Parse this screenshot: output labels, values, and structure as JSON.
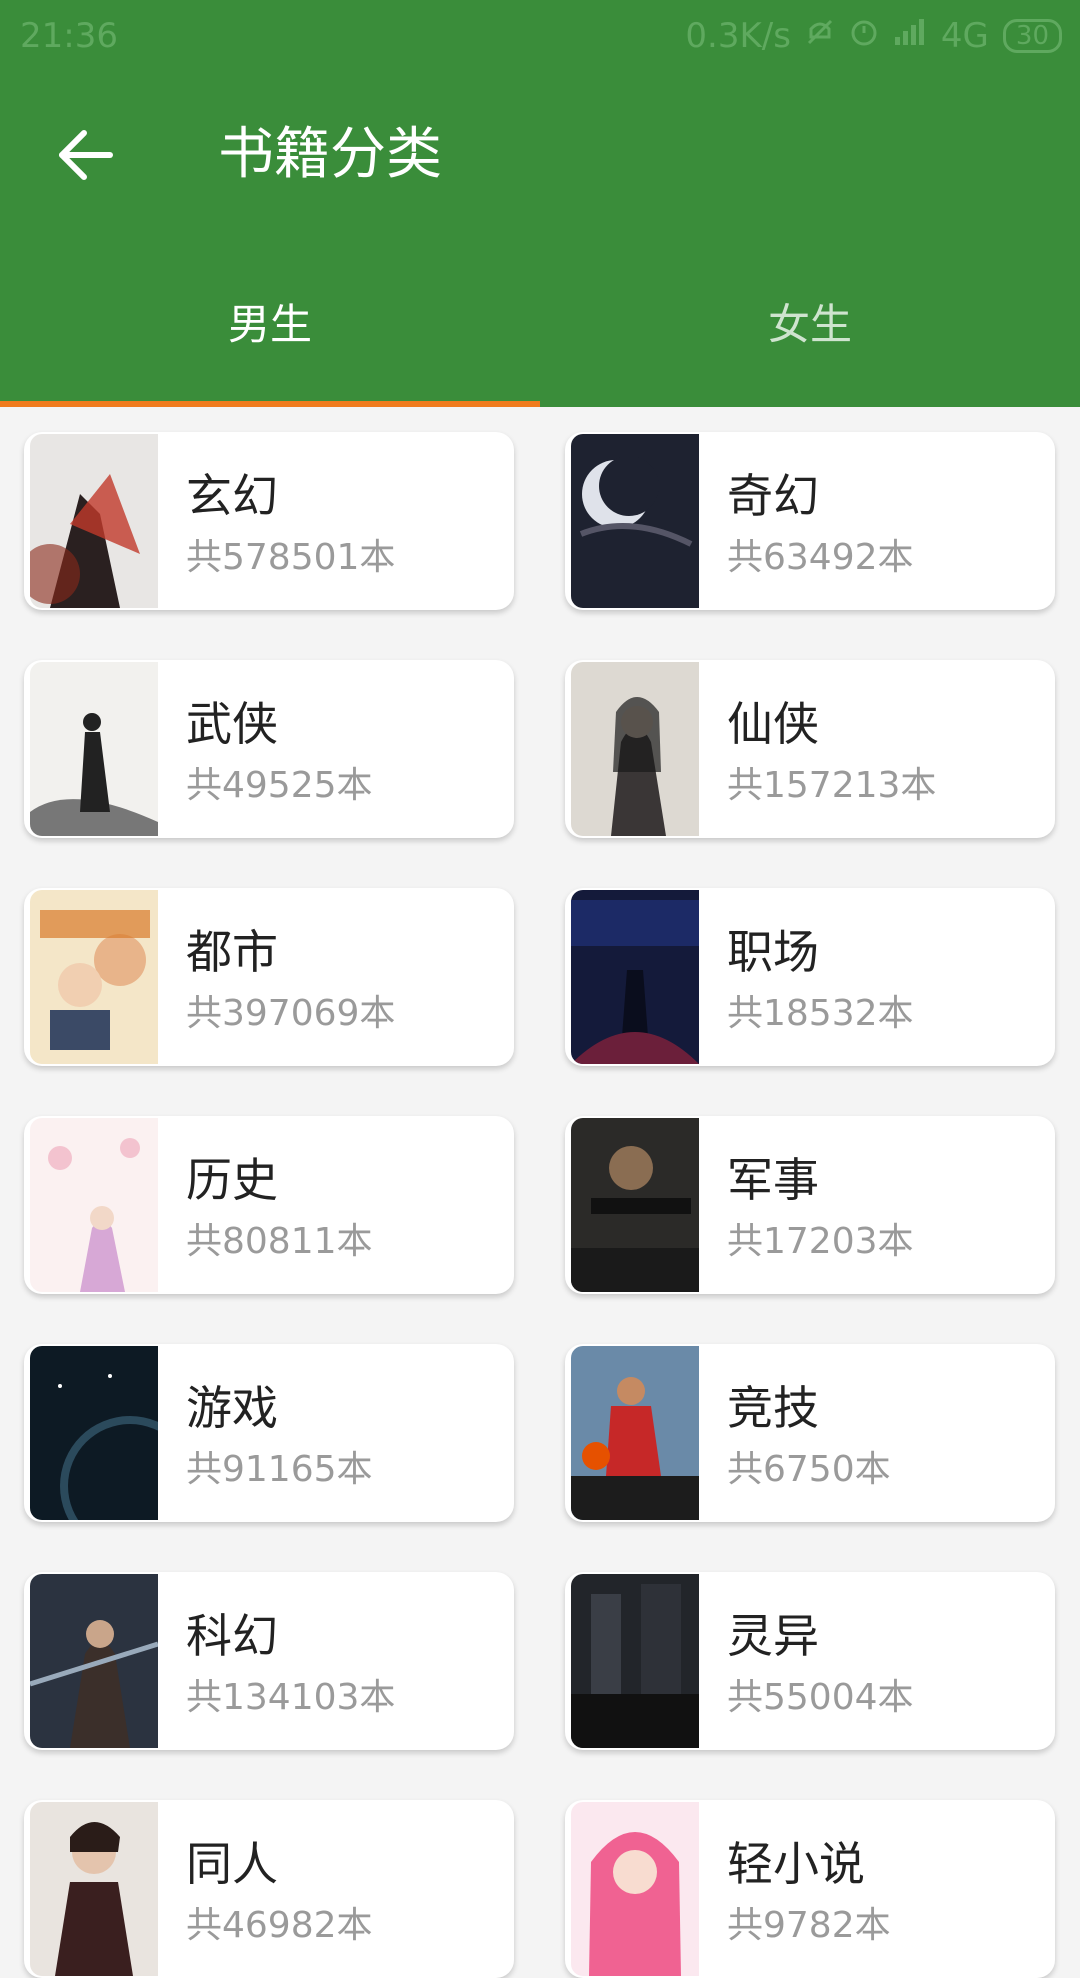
{
  "status_bar": {
    "time": "21:36",
    "net_speed": "0.3K/s",
    "network": "4G",
    "battery": "30"
  },
  "header": {
    "title": "书籍分类",
    "back_icon": "arrow-left-icon"
  },
  "tabs": [
    {
      "label": "男生",
      "active": true
    },
    {
      "label": "女生",
      "active": false
    }
  ],
  "colors": {
    "primary": "#3a8d3a",
    "indicator": "#f07b1d",
    "background": "#f4f4f4"
  },
  "categories": [
    {
      "name": "玄幻",
      "count": "共578501本"
    },
    {
      "name": "奇幻",
      "count": "共63492本"
    },
    {
      "name": "武侠",
      "count": "共49525本"
    },
    {
      "name": "仙侠",
      "count": "共157213本"
    },
    {
      "name": "都市",
      "count": "共397069本"
    },
    {
      "name": "职场",
      "count": "共18532本"
    },
    {
      "name": "历史",
      "count": "共80811本"
    },
    {
      "name": "军事",
      "count": "共17203本"
    },
    {
      "name": "游戏",
      "count": "共91165本"
    },
    {
      "name": "竞技",
      "count": "共6750本"
    },
    {
      "name": "科幻",
      "count": "共134103本"
    },
    {
      "name": "灵异",
      "count": "共55004本"
    },
    {
      "name": "同人",
      "count": "共46982本"
    },
    {
      "name": "轻小说",
      "count": "共9782本"
    }
  ]
}
